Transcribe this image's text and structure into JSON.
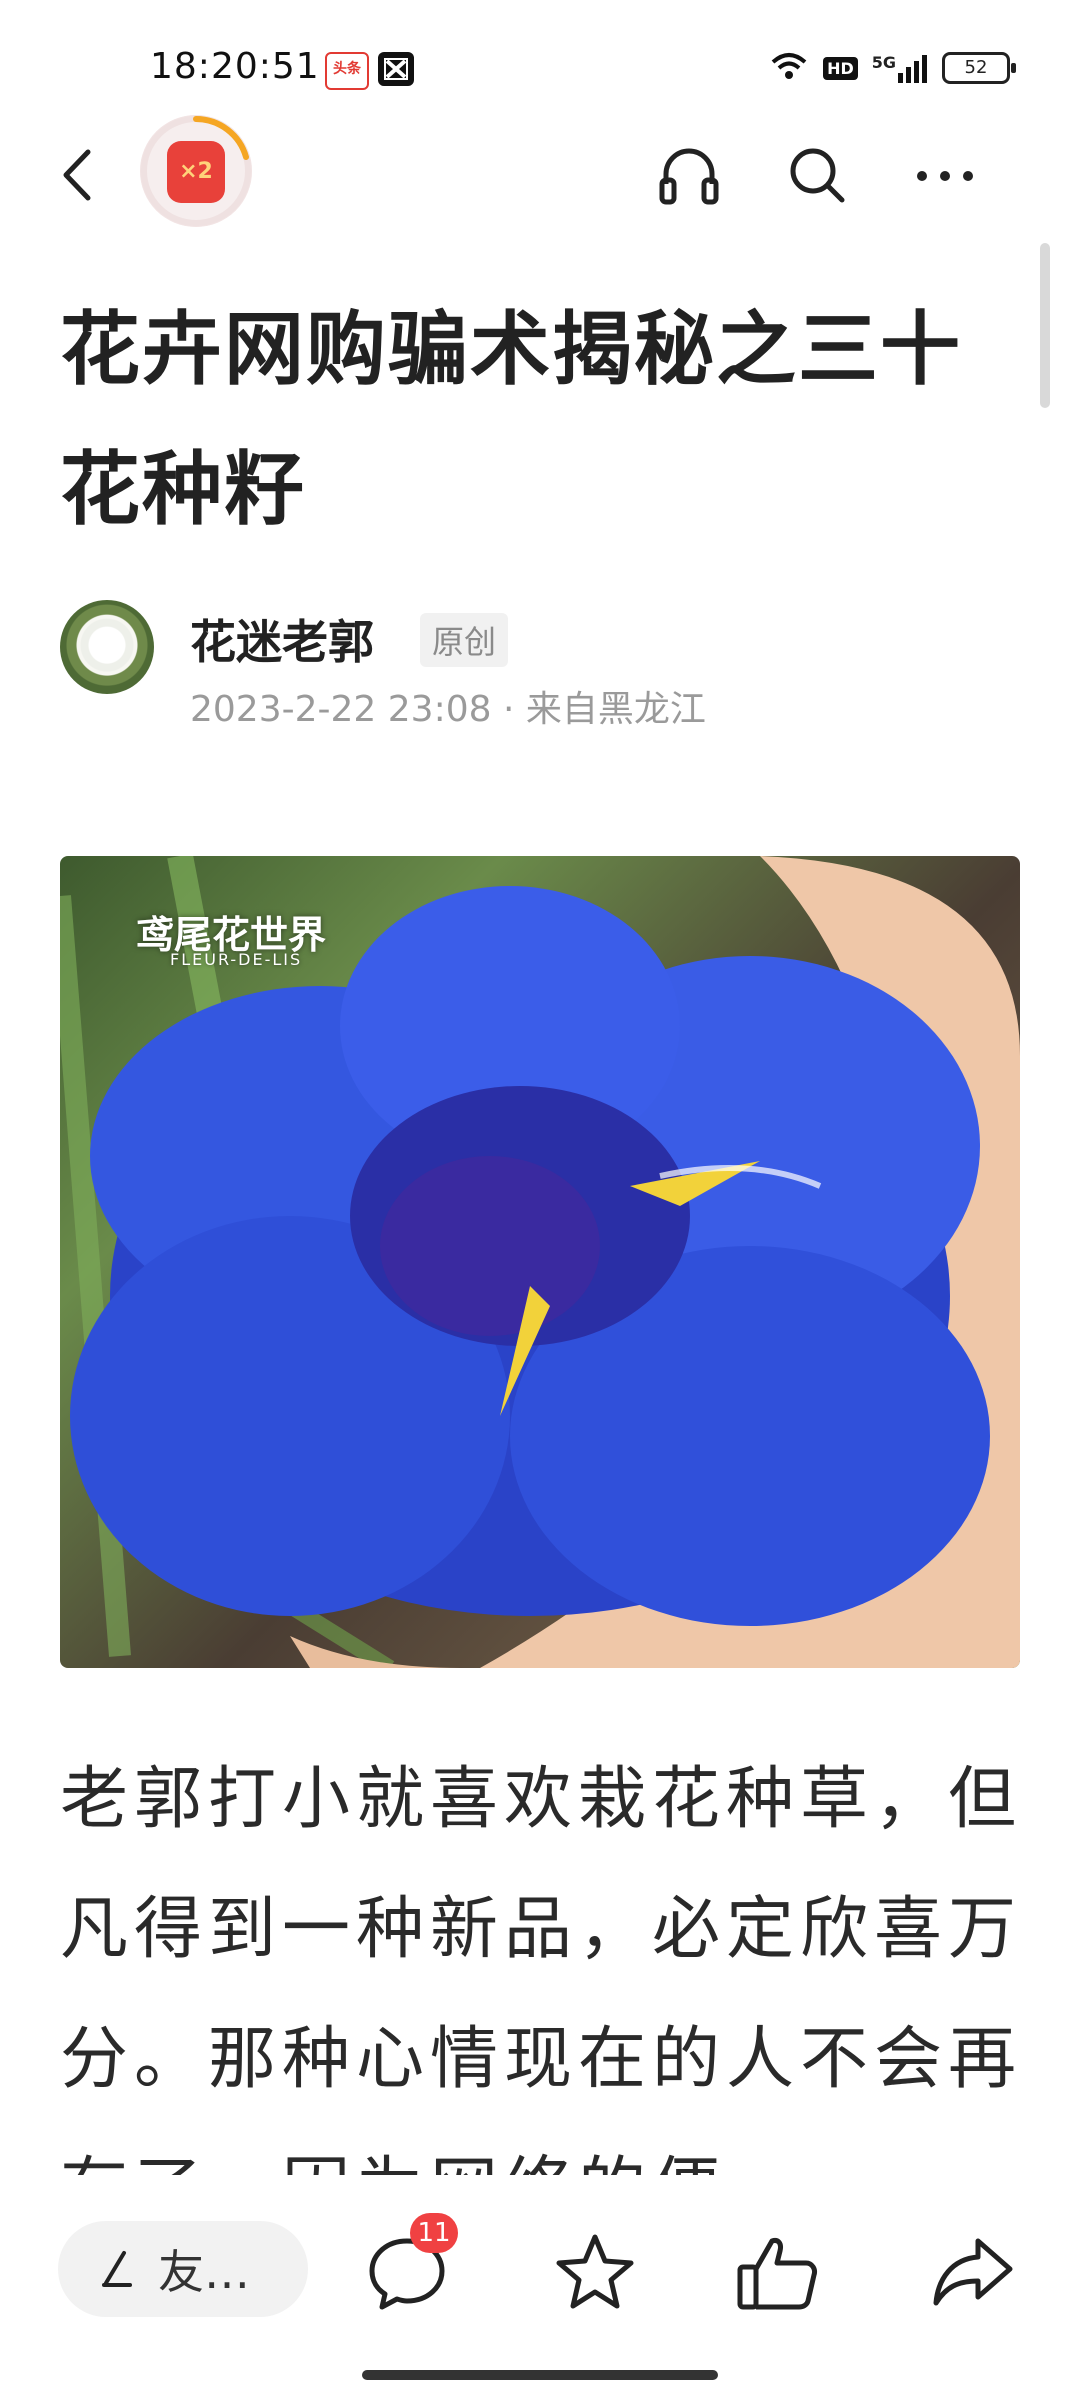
{
  "status_bar": {
    "time": "18:20:51",
    "app_icons": [
      "toutiao-icon",
      "capcut-icon"
    ],
    "hd_label": "HD",
    "network": "5G",
    "battery": "52"
  },
  "topbar": {
    "redpacket_label": "×2"
  },
  "article": {
    "title": "花卉网购骗术揭秘之三十 花种籽",
    "author": "花迷老郭",
    "badge": "原创",
    "meta": "2023-2-22 23:08 · 来自黑龙江",
    "image_watermark_cn": "鸢尾花世界",
    "image_watermark_en": "FLEUR-DE-LIS",
    "body": "老郭打小就喜欢栽花种草，但凡得到一种新品，必定欣喜万分。那种心情现在的人不会再有了，因为网络的便"
  },
  "bottom_bar": {
    "comment_placeholder": "友…",
    "comment_count": "11"
  },
  "colors": {
    "accent_red": "#f04142",
    "redpacket": "#e8413a",
    "text_primary": "#222222",
    "text_secondary": "#9a9a9a"
  }
}
